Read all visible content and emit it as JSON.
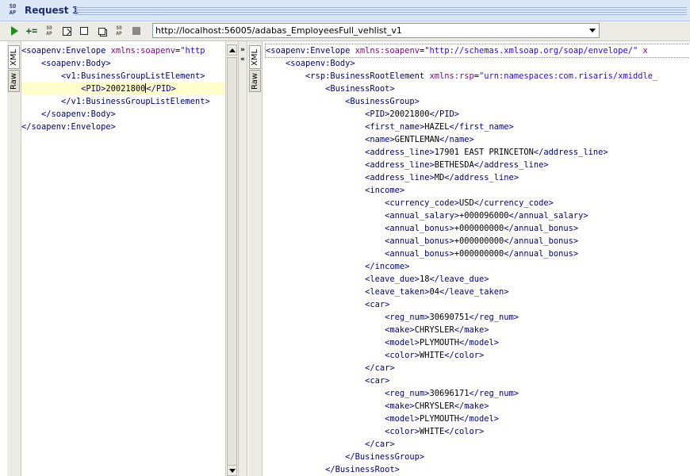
{
  "window": {
    "title": "Request 1",
    "logo_text": "SO\nAP"
  },
  "toolbar": {
    "soap_small_1": "SO\nAP",
    "soap_small_2": "SO\nAP",
    "url": "http://localhost:56005/adabas_EmployeesFull_vehlist_v1",
    "add_step_glyph": "+="
  },
  "tabs": {
    "xml_label": "XML",
    "raw_label": "Raw"
  },
  "splitter": {
    "collapse_glyph": "»",
    "expand_glyph": "«"
  },
  "request": {
    "lines": [
      "<span class='tag'>&lt;soapenv:Envelope</span> <span class='attr'>xmlns:soapenv</span><span class='txt'>=</span><span class='val'>\"http</span>",
      "    <span class='tag'>&lt;soapenv:Body&gt;</span>",
      "        <span class='tag'>&lt;v1:BusinessGroupListElement&gt;</span>",
      "            <span class='tag'>&lt;PID&gt;</span><span class='txt'>20021800</span><span class='caret'></span><span class='tag'>&lt;/PID&gt;</span>",
      "        <span class='tag'>&lt;/v1:BusinessGroupListElement&gt;</span>",
      "    <span class='tag'>&lt;/soapenv:Body&gt;</span>",
      "<span class='tag'>&lt;/soapenv:Envelope&gt;</span>"
    ]
  },
  "response": {
    "lines": [
      "<span class='tag'>&lt;soapenv:Envelope</span> <span class='attr'>xmlns:soapenv</span><span class='txt'>=</span><span class='val'>\"http://schemas.xmlsoap.org/soap/envelope/\"</span> <span class='attr'>x</span>",
      "    <span class='tag'>&lt;soapenv:Body&gt;</span>",
      "        <span class='tag'>&lt;rsp:BusinessRootElement</span> <span class='attr'>xmlns:rsp</span><span class='txt'>=</span><span class='val'>\"urn:namespaces:com.risaris/xmiddle_</span>",
      "            <span class='tag'>&lt;BusinessRoot&gt;</span>",
      "                <span class='tag'>&lt;BusinessGroup&gt;</span>",
      "                    <span class='tag'>&lt;PID&gt;</span><span class='txt'>20021800</span><span class='tag'>&lt;/PID&gt;</span>",
      "                    <span class='tag'>&lt;first_name&gt;</span><span class='txt'>HAZEL</span><span class='tag'>&lt;/first_name&gt;</span>",
      "                    <span class='tag'>&lt;name&gt;</span><span class='txt'>GENTLEMAN</span><span class='tag'>&lt;/name&gt;</span>",
      "                    <span class='tag'>&lt;address_line&gt;</span><span class='txt'>17901 EAST PRINCETON</span><span class='tag'>&lt;/address_line&gt;</span>",
      "                    <span class='tag'>&lt;address_line&gt;</span><span class='txt'>BETHESDA</span><span class='tag'>&lt;/address_line&gt;</span>",
      "                    <span class='tag'>&lt;address_line&gt;</span><span class='txt'>MD</span><span class='tag'>&lt;/address_line&gt;</span>",
      "                    <span class='tag'>&lt;income&gt;</span>",
      "                        <span class='tag'>&lt;currency_code&gt;</span><span class='txt'>USD</span><span class='tag'>&lt;/currency_code&gt;</span>",
      "                        <span class='tag'>&lt;annual_salary&gt;</span><span class='txt'>+000096000</span><span class='tag'>&lt;/annual_salary&gt;</span>",
      "                        <span class='tag'>&lt;annual_bonus&gt;</span><span class='txt'>+000000000</span><span class='tag'>&lt;/annual_bonus&gt;</span>",
      "                        <span class='tag'>&lt;annual_bonus&gt;</span><span class='txt'>+000000000</span><span class='tag'>&lt;/annual_bonus&gt;</span>",
      "                        <span class='tag'>&lt;annual_bonus&gt;</span><span class='txt'>+000000000</span><span class='tag'>&lt;/annual_bonus&gt;</span>",
      "                    <span class='tag'>&lt;/income&gt;</span>",
      "                    <span class='tag'>&lt;leave_due&gt;</span><span class='txt'>18</span><span class='tag'>&lt;/leave_due&gt;</span>",
      "                    <span class='tag'>&lt;leave_taken&gt;</span><span class='txt'>04</span><span class='tag'>&lt;/leave_taken&gt;</span>",
      "                    <span class='tag'>&lt;car&gt;</span>",
      "                        <span class='tag'>&lt;reg_num&gt;</span><span class='txt'>30690751</span><span class='tag'>&lt;/reg_num&gt;</span>",
      "                        <span class='tag'>&lt;make&gt;</span><span class='txt'>CHRYSLER</span><span class='tag'>&lt;/make&gt;</span>",
      "                        <span class='tag'>&lt;model&gt;</span><span class='txt'>PLYMOUTH</span><span class='tag'>&lt;/model&gt;</span>",
      "                        <span class='tag'>&lt;color&gt;</span><span class='txt'>WHITE</span><span class='tag'>&lt;/color&gt;</span>",
      "                    <span class='tag'>&lt;/car&gt;</span>",
      "                    <span class='tag'>&lt;car&gt;</span>",
      "                        <span class='tag'>&lt;reg_num&gt;</span><span class='txt'>30696171</span><span class='tag'>&lt;/reg_num&gt;</span>",
      "                        <span class='tag'>&lt;make&gt;</span><span class='txt'>CHRYSLER</span><span class='tag'>&lt;/make&gt;</span>",
      "                        <span class='tag'>&lt;model&gt;</span><span class='txt'>PLYMOUTH</span><span class='tag'>&lt;/model&gt;</span>",
      "                        <span class='tag'>&lt;color&gt;</span><span class='txt'>WHITE</span><span class='tag'>&lt;/color&gt;</span>",
      "                    <span class='tag'>&lt;/car&gt;</span>",
      "                <span class='tag'>&lt;/BusinessGroup&gt;</span>",
      "            <span class='tag'>&lt;/BusinessRoot&gt;</span>"
    ]
  }
}
